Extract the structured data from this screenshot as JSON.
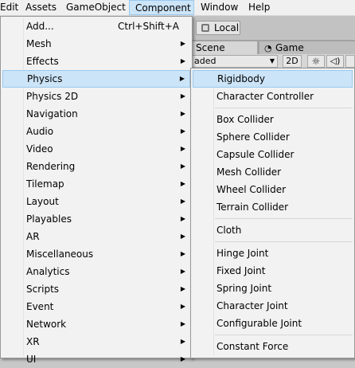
{
  "menubar": {
    "items": [
      "Edit",
      "Assets",
      "GameObject",
      "Component",
      "Window",
      "Help"
    ]
  },
  "editor": {
    "local_button": "Local",
    "tab_scene": "Scene",
    "tab_game": "Game",
    "shading_value": "aded",
    "toolbar_2d": "2D",
    "sun_glyph": "☼",
    "audio_glyph": "◁)"
  },
  "component_menu": {
    "items": [
      {
        "label": "Add...",
        "shortcut": "Ctrl+Shift+A",
        "submenu": false
      },
      {
        "label": "Mesh",
        "submenu": true
      },
      {
        "label": "Effects",
        "submenu": true
      },
      {
        "label": "Physics",
        "submenu": true,
        "highlighted": true
      },
      {
        "label": "Physics 2D",
        "submenu": true
      },
      {
        "label": "Navigation",
        "submenu": true
      },
      {
        "label": "Audio",
        "submenu": true
      },
      {
        "label": "Video",
        "submenu": true
      },
      {
        "label": "Rendering",
        "submenu": true
      },
      {
        "label": "Tilemap",
        "submenu": true
      },
      {
        "label": "Layout",
        "submenu": true
      },
      {
        "label": "Playables",
        "submenu": true
      },
      {
        "label": "AR",
        "submenu": true
      },
      {
        "label": "Miscellaneous",
        "submenu": true
      },
      {
        "label": "Analytics",
        "submenu": true
      },
      {
        "label": "Scripts",
        "submenu": true
      },
      {
        "label": "Event",
        "submenu": true
      },
      {
        "label": "Network",
        "submenu": true
      },
      {
        "label": "XR",
        "submenu": true
      },
      {
        "label": "UI",
        "submenu": true
      }
    ]
  },
  "physics_submenu": {
    "groups": [
      [
        "Rigidbody",
        "Character Controller"
      ],
      [
        "Box Collider",
        "Sphere Collider",
        "Capsule Collider",
        "Mesh Collider",
        "Wheel Collider",
        "Terrain Collider"
      ],
      [
        "Cloth"
      ],
      [
        "Hinge Joint",
        "Fixed Joint",
        "Spring Joint",
        "Character Joint",
        "Configurable Joint"
      ],
      [
        "Constant Force"
      ]
    ],
    "highlighted": "Rigidbody"
  },
  "icons": {
    "submenu_arrow": "▶",
    "dropdown_arrow": "▼",
    "game_tab_icon": "pacman-icon",
    "local_icon": "cube-icon"
  }
}
